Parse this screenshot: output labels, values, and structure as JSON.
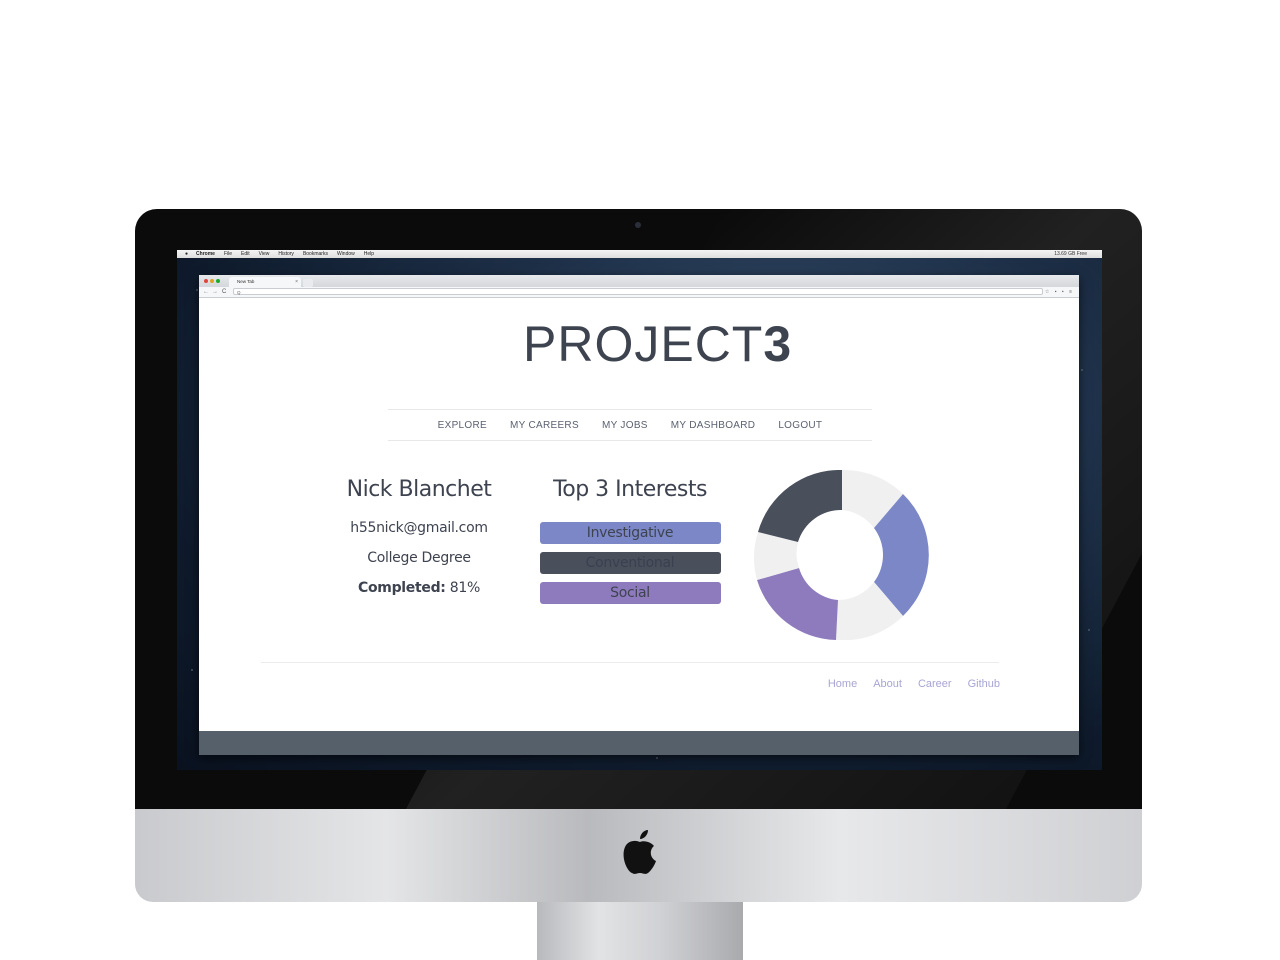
{
  "mac_menubar": {
    "app": "Chrome",
    "items": [
      "File",
      "Edit",
      "View",
      "History",
      "Bookmarks",
      "Window",
      "Help"
    ],
    "status": "13.69 GB Free"
  },
  "browser": {
    "tab_title": "New Tab",
    "tab_close": "×",
    "back": "←",
    "forward": "→",
    "reload": "C",
    "address_icon": "Q",
    "address_value": ""
  },
  "site": {
    "logo_text": "PROJECT",
    "logo_bold": "3",
    "nav": [
      "EXPLORE",
      "MY CAREERS",
      "MY JOBS",
      "MY DASHBOARD",
      "LOGOUT"
    ]
  },
  "profile": {
    "name": "Nick Blanchet",
    "email": "h55nick@gmail.com",
    "education": "College Degree",
    "completed_label": "Completed:",
    "completed_value": "81%"
  },
  "interests": {
    "title": "Top 3 Interests",
    "items": [
      "Investigative",
      "Conventional",
      "Social"
    ],
    "colors": [
      "#7b87c6",
      "#4a4f5c",
      "#8e7bbd"
    ]
  },
  "footer": {
    "links": [
      "Home",
      "About",
      "Career",
      "Github"
    ]
  }
}
